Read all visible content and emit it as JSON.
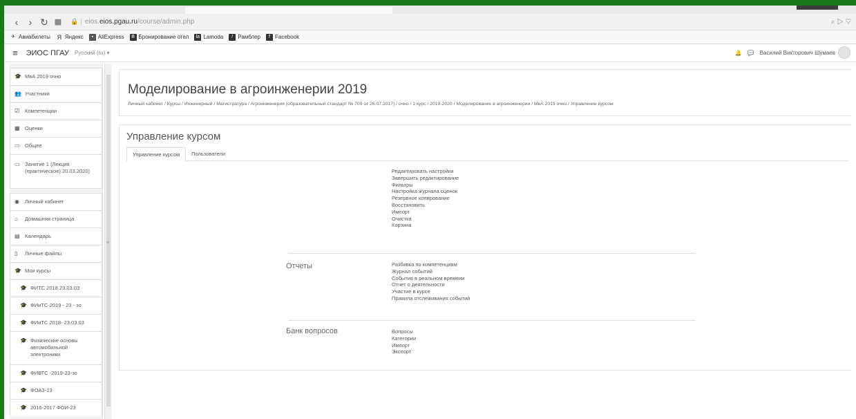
{
  "browser": {
    "url_host": "eios.pgau.ru",
    "url_path": "/course/admin.php",
    "url_prefix": "eios.",
    "bookmarks": [
      "Авиабилеты",
      "Яндекс",
      "AliExpress",
      "Бронирование отел",
      "Lamoda",
      "Рамблер",
      "Facebook"
    ]
  },
  "navbar": {
    "brand": "ЭИОС ПГАУ",
    "lang": "Русский (ru) ▾",
    "user": "Василий Викторович Шумаев"
  },
  "drawer": {
    "items": [
      {
        "label": "МвА 2019 очно",
        "icon": "graduation-cap-icon",
        "glyph": "🎓"
      },
      {
        "label": "Участники",
        "icon": "users-icon",
        "glyph": "👥"
      },
      {
        "label": "Компетенции",
        "icon": "check-square-icon",
        "glyph": "☑"
      },
      {
        "label": "Оценки",
        "icon": "table-icon",
        "glyph": "▦"
      },
      {
        "label": "Общее",
        "icon": "folder-icon",
        "glyph": "▭"
      },
      {
        "label": "Занятие 1 (Лекция (практическое) 20.03.2020)",
        "icon": "folder-icon",
        "glyph": "▭"
      },
      {
        "label": "Личный кабинет",
        "icon": "dashboard-icon",
        "glyph": "◉"
      },
      {
        "label": "Домашняя страница",
        "icon": "home-icon",
        "glyph": "⌂"
      },
      {
        "label": "Календарь",
        "icon": "calendar-icon",
        "glyph": "▤"
      },
      {
        "label": "Личные файлы",
        "icon": "file-icon",
        "glyph": "▯"
      },
      {
        "label": "Мои курсы",
        "icon": "graduation-cap-icon",
        "glyph": "🎓"
      },
      {
        "label": "ФИТС 2018 23.03.03",
        "icon": "graduation-cap-icon",
        "glyph": "🎓"
      },
      {
        "label": "ФИиТС-2019 - 23 - зо",
        "icon": "graduation-cap-icon",
        "glyph": "🎓"
      },
      {
        "label": "ФИиТС 2018- 23.03.03",
        "icon": "graduation-cap-icon",
        "glyph": "🎓"
      },
      {
        "label": "Физические основы автомобильной электроники",
        "icon": "graduation-cap-icon",
        "glyph": "🎓"
      },
      {
        "label": "ФИВТС -2019-23-зо",
        "icon": "graduation-cap-icon",
        "glyph": "🎓"
      },
      {
        "label": "ФОАЗ-23",
        "icon": "graduation-cap-icon",
        "glyph": "🎓"
      },
      {
        "label": "2016-2017 ФОИ-23",
        "icon": "graduation-cap-icon",
        "glyph": "🎓"
      }
    ]
  },
  "header": {
    "title": "Моделирование в агроинженерии 2019",
    "breadcrumb": "Личный кабинет / Курсы / Инженерный / Магистратура / Агроинженерия (образовательный стандарт № 709 от 26.07.2017) / очно / 1 курс / 2019-2020 / Моделирование в агроинженерии / МвА 2019 очно / Управление курсом"
  },
  "main": {
    "section_title": "Управление курсом",
    "tabs": [
      "Управление курсом",
      "Пользователи"
    ],
    "groups": [
      {
        "label": "",
        "links": [
          "Редактировать настройки",
          "Завершить редактирование",
          "Фильтры",
          "Настройка журнала оценок",
          "Резервное копирование",
          "Восстановить",
          "Импорт",
          "Очистка",
          "Корзина"
        ]
      },
      {
        "label": "Отчеты",
        "links": [
          "Разбивка по компетенциям",
          "Журнал событий",
          "События в реальном времени",
          "Отчет о деятельности",
          "Участие в курсе",
          "Правила отслеживания событий"
        ]
      },
      {
        "label": "Банк вопросов",
        "links": [
          "Вопросы",
          "Категории",
          "Импорт",
          "Экспорт"
        ]
      }
    ]
  }
}
